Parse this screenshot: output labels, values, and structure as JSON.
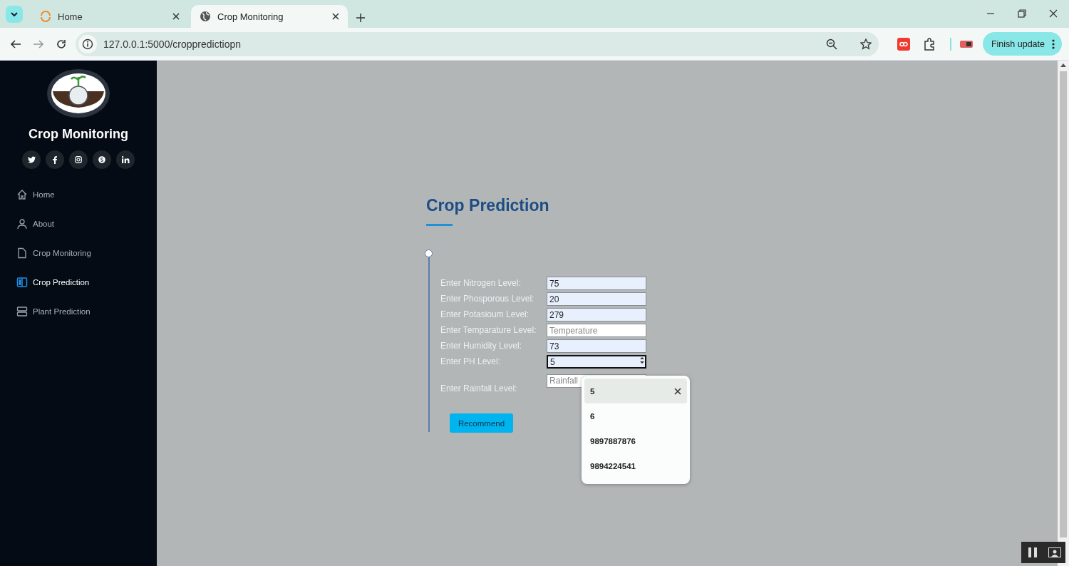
{
  "browser": {
    "tabs": [
      {
        "title": "Home",
        "selected": false
      },
      {
        "title": "Crop Monitoring",
        "selected": true
      }
    ],
    "address": "127.0.0.1:5000/croppredictiopn",
    "update_button": "Finish update"
  },
  "sidebar": {
    "brand": "Crop Monitoring",
    "nav": [
      {
        "label": "Home",
        "selected": false
      },
      {
        "label": "About",
        "selected": false
      },
      {
        "label": "Crop Monitoring",
        "selected": false
      },
      {
        "label": "Crop Prediction",
        "selected": true
      },
      {
        "label": "Plant Prediction",
        "selected": false
      }
    ]
  },
  "page": {
    "title": "Crop Prediction",
    "fields": [
      {
        "label": "Enter Nitrogen Level:",
        "value": "75",
        "focused": false
      },
      {
        "label": "Enter Phosporous Level:",
        "value": "20",
        "focused": false
      },
      {
        "label": "Enter Potasioum Level:",
        "value": "279",
        "focused": false
      },
      {
        "label": "Enter Temparature Level:",
        "placeholder": "Temperature",
        "focused": false
      },
      {
        "label": "Enter Humidity Level:",
        "value": "73",
        "focused": false
      },
      {
        "label": "Enter PH Level:",
        "value": "5",
        "focused": true
      },
      {
        "label": "Enter Rainfall Level:",
        "placeholder": "Rainfall",
        "focused": false
      }
    ],
    "button": "Recommend",
    "autofill": [
      {
        "text": "5",
        "selected": true
      },
      {
        "text": "6",
        "selected": false
      },
      {
        "text": "9897887876",
        "selected": false
      },
      {
        "text": "9894224541",
        "selected": false
      }
    ]
  }
}
